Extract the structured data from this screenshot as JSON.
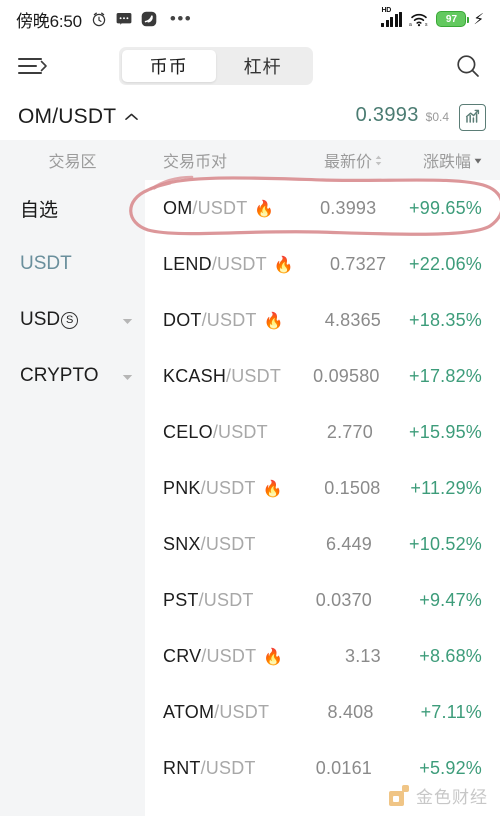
{
  "statusbar": {
    "time": "傍晚6:50",
    "alarm_icon": "alarm-clock-icon",
    "message_icon": "message-icon",
    "app_icon": "app-badge-icon",
    "more_dots": "•••",
    "network_label": "HD",
    "wifi_icon": "wifi-icon",
    "battery_level": "97",
    "charging_icon": "lightning-bolt-icon"
  },
  "topnav": {
    "menu_icon": "menu-arrow-icon",
    "search_icon": "search-icon",
    "tabs": [
      {
        "label": "币币",
        "active": true
      },
      {
        "label": "杠杆",
        "active": false
      }
    ]
  },
  "ticker": {
    "pair": "OM/USDT",
    "caret_icon": "chevron-up-icon",
    "price": "0.3993",
    "usd_value": "$0.4",
    "chart_icon": "chart-trend-icon"
  },
  "columns": {
    "zone": "交易区",
    "pair": "交易币对",
    "price": "最新价",
    "change": "涨跌幅",
    "price_sort_icon": "sort-both-icon",
    "change_sort_icon": "sort-desc-icon"
  },
  "sidebar": {
    "items": [
      {
        "label": "自选",
        "selected": true,
        "expandable": false
      },
      {
        "label": "USDT",
        "selected": false,
        "expandable": false
      },
      {
        "label": "USD",
        "suffix": "S",
        "selected": false,
        "expandable": true
      },
      {
        "label": "CRYPTO",
        "selected": false,
        "expandable": true
      }
    ]
  },
  "list": {
    "rows": [
      {
        "base": "OM",
        "quote": "/USDT",
        "hot": true,
        "price": "0.3993",
        "change": "+99.65%"
      },
      {
        "base": "LEND",
        "quote": "/USDT",
        "hot": true,
        "price": "0.7327",
        "change": "+22.06%"
      },
      {
        "base": "DOT",
        "quote": "/USDT",
        "hot": true,
        "price": "4.8365",
        "change": "+18.35%"
      },
      {
        "base": "KCASH",
        "quote": "/USDT",
        "hot": false,
        "price": "0.09580",
        "change": "+17.82%"
      },
      {
        "base": "CELO",
        "quote": "/USDT",
        "hot": false,
        "price": "2.770",
        "change": "+15.95%"
      },
      {
        "base": "PNK",
        "quote": "/USDT",
        "hot": true,
        "price": "0.1508",
        "change": "+11.29%"
      },
      {
        "base": "SNX",
        "quote": "/USDT",
        "hot": false,
        "price": "6.449",
        "change": "+10.52%"
      },
      {
        "base": "PST",
        "quote": "/USDT",
        "hot": false,
        "price": "0.0370",
        "change": "+9.47%"
      },
      {
        "base": "CRV",
        "quote": "/USDT",
        "hot": true,
        "price": "3.13",
        "change": "+8.68%"
      },
      {
        "base": "ATOM",
        "quote": "/USDT",
        "hot": false,
        "price": "8.408",
        "change": "+7.11%"
      },
      {
        "base": "RNT",
        "quote": "/USDT",
        "hot": false,
        "price": "0.0161",
        "change": "+5.92%"
      }
    ]
  },
  "annotation": {
    "shape": "hand-drawn-red-ellipse",
    "target": "OM/USDT row",
    "color": "#d98e91"
  },
  "watermark": {
    "text": "金色财经",
    "logo_icon": "jinse-logo-icon",
    "color": "#e8a33d"
  },
  "colors": {
    "positive": "#3d9c7a",
    "muted": "#8a8a8a",
    "sidebar_bg": "#f4f5f6",
    "accent_usdt": "#6a8f9c",
    "flame": "#f2a63a"
  }
}
